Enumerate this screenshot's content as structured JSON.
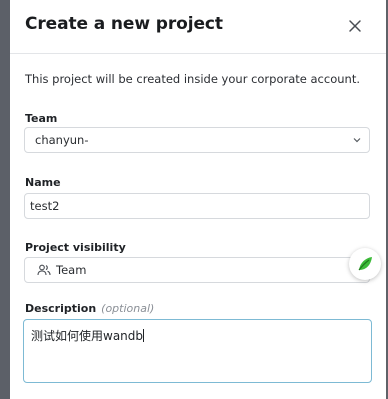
{
  "modal": {
    "title": "Create a new project",
    "intro": "This project will be created inside your corporate account."
  },
  "team": {
    "label": "Team",
    "value": "chanyun-"
  },
  "name": {
    "label": "Name",
    "value": "test2"
  },
  "visibility": {
    "label": "Project visibility",
    "value": "Team"
  },
  "description": {
    "label": "Description",
    "optional": "(optional)",
    "value": "测试如何使用wandb"
  },
  "colors": {
    "focus_border": "#7dbad4",
    "fab_leaf": "#3dbb3a"
  }
}
